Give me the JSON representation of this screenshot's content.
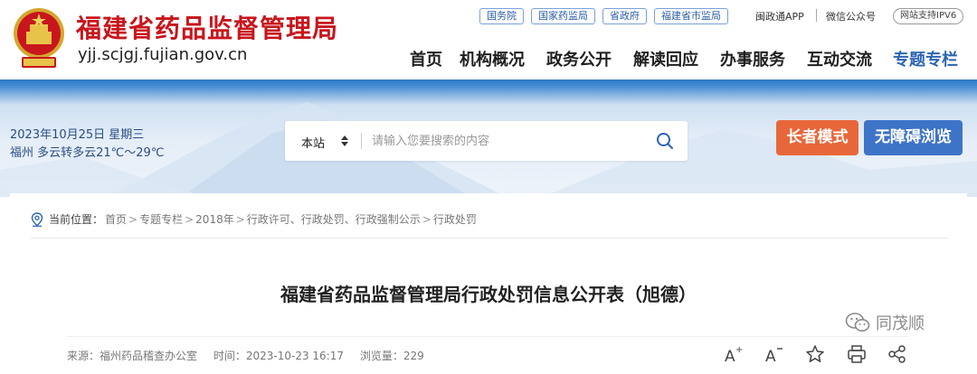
{
  "header": {
    "site_title": "福建省药品监督管理局",
    "domain": "yjj.scjgj.fujian.gov.cn",
    "emblem_icon": "national-emblem-icon",
    "top_links": [
      "国务院",
      "国家药监局",
      "省政府",
      "福建省市监局"
    ],
    "app_link": "闽政通APP",
    "wechat_link": "微信公众号",
    "ipv6_badge": "网站支持IPV6",
    "nav": [
      "首页",
      "机构概况",
      "政务公开",
      "解读回应",
      "办事服务",
      "互动交流",
      "专题专栏"
    ],
    "active_nav": "专题专栏"
  },
  "banner": {
    "date": "2023年10月25日 星期三",
    "weather": "福州 多云转多云21℃～29℃",
    "search": {
      "scope": "本站",
      "placeholder": "请输入您要搜索的内容",
      "icon": "search-icon"
    },
    "elder_mode": "长者模式",
    "accessible": "无障碍浏览"
  },
  "breadcrumb": {
    "label": "当前位置：",
    "icon": "location-pin-icon",
    "items": [
      "首页",
      "专题专栏",
      "2018年",
      "行政许可、行政处罚、行政强制公示",
      "行政处罚"
    ],
    "separator": ">"
  },
  "article": {
    "title": "福建省药品监督管理局行政处罚信息公开表（旭德）",
    "source": "来源：福州药品稽查办公室",
    "time": "时间：2023-10-23 16:17",
    "views": "浏览量：229"
  },
  "tools": [
    "font-increase-icon",
    "font-decrease-icon",
    "favorite-star-icon",
    "print-icon",
    "share-icon"
  ],
  "watermark": {
    "text": "同茂顺",
    "icon": "wechat-icon"
  },
  "colors": {
    "brand_red": "#c8161d",
    "nav_active": "#2b64b3",
    "elder_button": "#e8673a",
    "access_button": "#3d74c8",
    "banner_top": "#2a79c7"
  }
}
